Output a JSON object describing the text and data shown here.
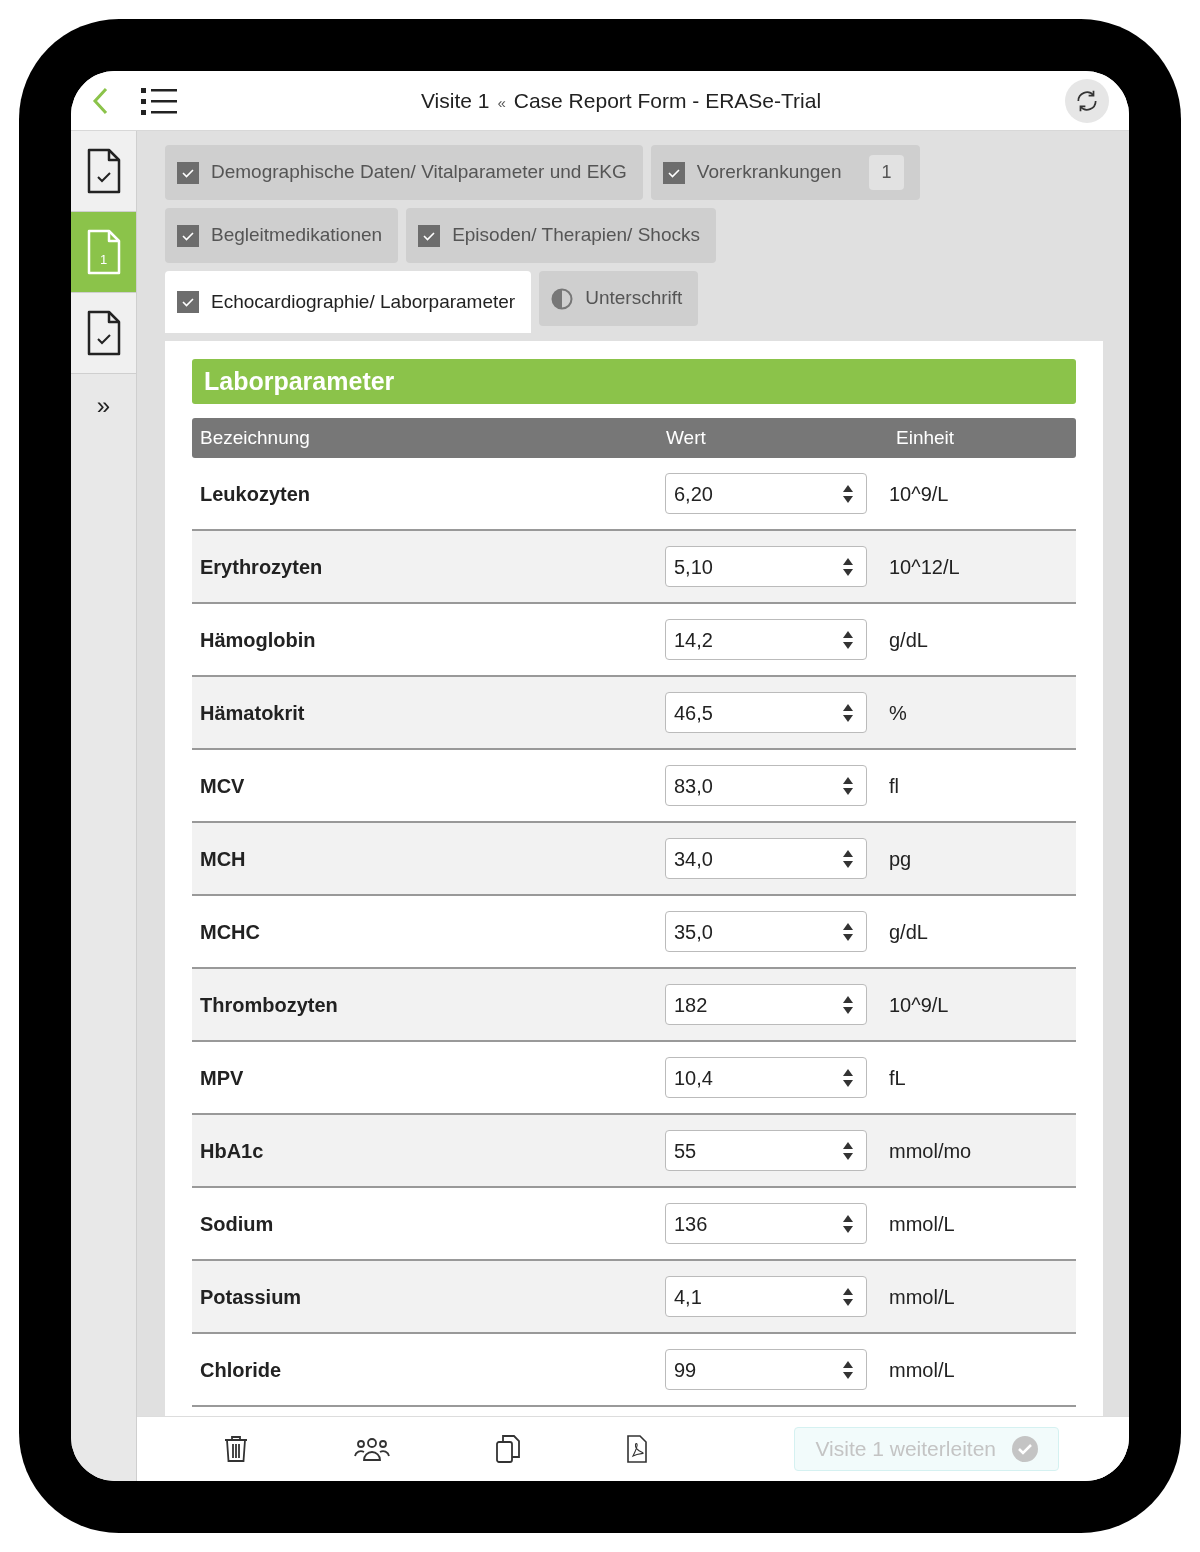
{
  "header": {
    "title_prefix": "Visite 1",
    "separator": "«",
    "title": "Case Report Form - ERASe-Trial"
  },
  "sidebar": {
    "items": [
      {
        "kind": "checked",
        "selected": false
      },
      {
        "kind": "numbered",
        "label": "1",
        "selected": true
      },
      {
        "kind": "checked",
        "selected": false
      }
    ],
    "expand": "»"
  },
  "tab_rows": [
    [
      {
        "label": "Demographische Daten/ Vitalparameter und EKG",
        "kind": "checkbox",
        "checked": true,
        "selected": false
      },
      {
        "label": "Vorerkrankungen",
        "kind": "checkbox",
        "checked": true,
        "selected": false,
        "badge": "1"
      }
    ],
    [
      {
        "label": "Begleitmedikationen",
        "kind": "checkbox",
        "checked": true,
        "selected": false
      },
      {
        "label": "Episoden/ Therapien/ Shocks",
        "kind": "checkbox",
        "checked": true,
        "selected": false
      }
    ],
    [
      {
        "label": "Echocardiographie/ Laborparameter",
        "kind": "checkbox",
        "checked": true,
        "selected": true
      },
      {
        "label": "Unterschrift",
        "kind": "partial",
        "selected": false
      }
    ]
  ],
  "section": {
    "title": "Laborparameter"
  },
  "table": {
    "columns": [
      "Bezeichnung",
      "Wert",
      "Einheit"
    ],
    "rows": [
      {
        "name": "Leukozyten",
        "value": "6,20",
        "unit": "10^9/L"
      },
      {
        "name": "Erythrozyten",
        "value": "5,10",
        "unit": "10^12/L"
      },
      {
        "name": "Hämoglobin",
        "value": "14,2",
        "unit": "g/dL"
      },
      {
        "name": "Hämatokrit",
        "value": "46,5",
        "unit": "%"
      },
      {
        "name": "MCV",
        "value": "83,0",
        "unit": "fl"
      },
      {
        "name": "MCH",
        "value": "34,0",
        "unit": "pg"
      },
      {
        "name": "MCHC",
        "value": "35,0",
        "unit": "g/dL"
      },
      {
        "name": "Thrombozyten",
        "value": "182",
        "unit": "10^9/L"
      },
      {
        "name": "MPV",
        "value": "10,4",
        "unit": "fL"
      },
      {
        "name": "HbA1c",
        "value": "55",
        "unit": "mmol/mo"
      },
      {
        "name": "Sodium",
        "value": "136",
        "unit": "mmol/L"
      },
      {
        "name": "Potassium",
        "value": "4,1",
        "unit": "mmol/L"
      },
      {
        "name": "Chloride",
        "value": "99",
        "unit": "mmol/L"
      }
    ]
  },
  "toolbar": {
    "forward_button": {
      "label": "Visite 1 weiterleiten",
      "disabled": true
    }
  }
}
